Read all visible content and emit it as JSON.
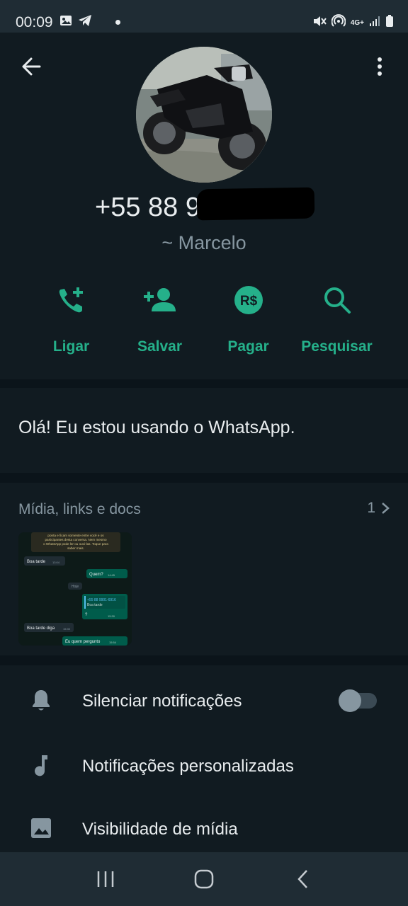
{
  "status_bar": {
    "time": "00:09",
    "network": "4G+"
  },
  "contact": {
    "phone": "+55 88 9",
    "name": "~ Marcelo"
  },
  "actions": [
    {
      "label": "Ligar",
      "icon": "add-call-icon"
    },
    {
      "label": "Salvar",
      "icon": "add-person-icon"
    },
    {
      "label": "Pagar",
      "icon": "real-currency-icon"
    },
    {
      "label": "Pesquisar",
      "icon": "search-icon"
    }
  ],
  "about": {
    "text": "Olá! Eu estou usando o WhatsApp."
  },
  "media": {
    "title": "Mídia, links e docs",
    "count": "1",
    "thumb": {
      "banner": "ponta e ficam somente entre você e os participantes desta conversa. Nem mesmo o WhatsApp pode ler ou ouvi-las. Toque para saber mais.",
      "msg1": "Boa tarde",
      "msg1_time": "13:04",
      "msg2": "Quem?",
      "msg2_time": "14:45",
      "date": "Hoje",
      "msg3_quote": "+55 88 9901-6916",
      "msg3_quote_text": "Boa tarde",
      "msg3": "?",
      "msg3_time": "15:30",
      "msg4": "Boa tarde diga",
      "msg4_time": "15:30",
      "msg5": "Eu quem pergunto",
      "msg5_time": "15:54"
    }
  },
  "settings": [
    {
      "label": "Silenciar notificações",
      "icon": "bell-icon"
    },
    {
      "label": "Notificações personalizadas",
      "icon": "music-note-icon"
    },
    {
      "label": "Visibilidade de mídia",
      "icon": "image-icon"
    }
  ],
  "colors": {
    "accent": "#25b08a",
    "background": "#111b21",
    "separator": "#0b141a",
    "secondary_text": "#8696a0"
  }
}
